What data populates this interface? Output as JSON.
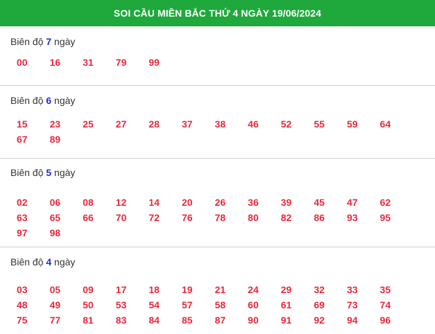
{
  "header": {
    "title": "SOI CẦU MIỀN BẮC THỨ 4 NGÀY 19/06/2024"
  },
  "sections": [
    {
      "prefix": "Biên độ ",
      "days": "7",
      "suffix": " ngày",
      "numbers": [
        "00",
        "16",
        "31",
        "79",
        "99"
      ]
    },
    {
      "prefix": "Biên độ ",
      "days": "6",
      "suffix": " ngày",
      "numbers": [
        "15",
        "23",
        "25",
        "27",
        "28",
        "37",
        "38",
        "46",
        "52",
        "55",
        "59",
        "64",
        "67",
        "89"
      ]
    },
    {
      "prefix": "Biên độ ",
      "days": "5",
      "suffix": " ngày",
      "numbers": [
        "02",
        "06",
        "08",
        "12",
        "14",
        "20",
        "26",
        "36",
        "39",
        "45",
        "47",
        "62",
        "63",
        "65",
        "66",
        "70",
        "72",
        "76",
        "78",
        "80",
        "82",
        "86",
        "93",
        "95",
        "97",
        "98"
      ]
    },
    {
      "prefix": "Biên độ ",
      "days": "4",
      "suffix": " ngày",
      "numbers": [
        "03",
        "05",
        "09",
        "17",
        "18",
        "19",
        "21",
        "24",
        "29",
        "32",
        "33",
        "35",
        "48",
        "49",
        "50",
        "53",
        "54",
        "57",
        "58",
        "60",
        "61",
        "69",
        "73",
        "74",
        "75",
        "77",
        "81",
        "83",
        "84",
        "85",
        "87",
        "90",
        "91",
        "92",
        "94",
        "96"
      ]
    }
  ],
  "colors": {
    "header_bg": "#1fa83c",
    "number": "#e8283a",
    "days": "#1a2fd6"
  }
}
